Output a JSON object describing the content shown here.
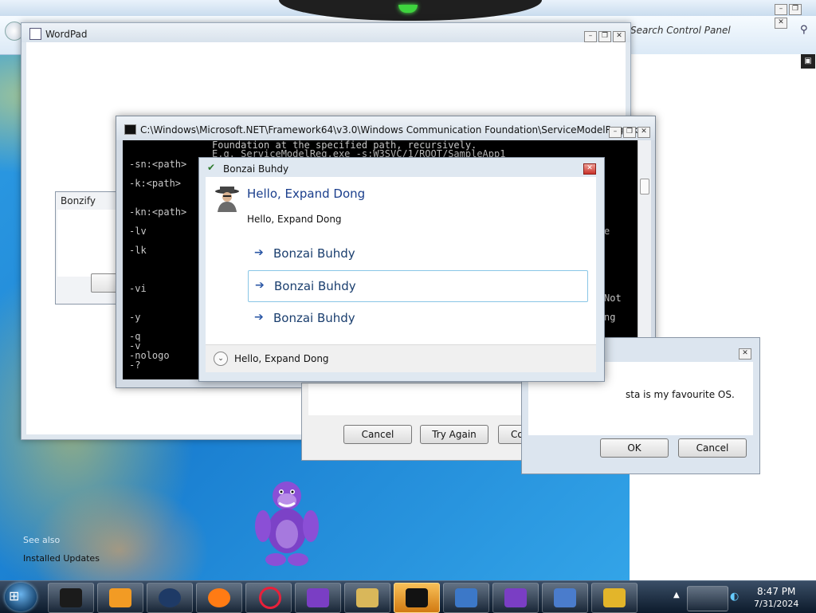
{
  "control_panel": {
    "search_placeholder": "Search Control Panel",
    "see_also": "See also",
    "installed_updates": "Installed Updates"
  },
  "wordpad": {
    "title": "WordPad"
  },
  "bonzify": {
    "title": "Bonzify"
  },
  "cmd": {
    "title": "C:\\Windows\\Microsoft.NET\\Framework64\\v3.0\\Windows Communication Foundation\\ServiceModelReg.exe",
    "lines": [
      {
        "left": "",
        "right": "Foundation at the specified path, recursively."
      },
      {
        "left": "",
        "right": "E.g. ServiceModelReg.exe -s:W3SVC/1/ROOT/SampleApp1"
      },
      {
        "left": "-sn:<path>",
        "right": ""
      },
      {
        "left": "-k:<path>",
        "right": ""
      },
      {
        "left": "-kn:<path>",
        "right": ""
      },
      {
        "left": "-lv",
        "right": ""
      },
      {
        "left": "-lk",
        "right": ""
      },
      {
        "left": "-vi",
        "right": ""
      },
      {
        "left": "-y",
        "right": ""
      },
      {
        "left": "-q",
        "right": ""
      },
      {
        "left": "-v",
        "right": ""
      },
      {
        "left": "-nologo",
        "right": ""
      },
      {
        "left": "-?",
        "right": ""
      }
    ],
    "right_fragments": [
      "e",
      "Not",
      "ng"
    ]
  },
  "try_again_dialog": {
    "buttons": [
      "Cancel",
      "Try Again",
      "Continue"
    ]
  },
  "vista_dialog": {
    "message": "sta is my favourite OS.",
    "ok_label": "OK",
    "cancel_label": "Cancel"
  },
  "bonzai_dialog": {
    "title": "Bonzai Buhdy",
    "main_instruction": "Hello, Expand Dong",
    "content": "Hello, Expand Dong",
    "command_links": [
      "Bonzai Buhdy",
      "Bonzai Buhdy",
      "Bonzai Buhdy"
    ],
    "footer_text": "Hello, Expand Dong"
  },
  "taskbar": {
    "time": "8:47 PM",
    "date": "7/31/2024",
    "items": [
      {
        "name": "taskbar-item-black-box",
        "icon": "black-cube-icon",
        "color": "#1b1b1b"
      },
      {
        "name": "taskbar-item-media-player",
        "icon": "media-player-icon",
        "color": "#f29b24"
      },
      {
        "name": "taskbar-item-dark-globe",
        "icon": "dark-globe-icon",
        "color": "#1e3a66"
      },
      {
        "name": "taskbar-item-firefox",
        "icon": "firefox-icon",
        "color": "#ff7b14"
      },
      {
        "name": "taskbar-item-opera",
        "icon": "opera-icon",
        "color": "#e8203a"
      },
      {
        "name": "taskbar-item-bonzi",
        "icon": "bonzi-icon",
        "color": "#7a3ec4"
      },
      {
        "name": "taskbar-item-agent",
        "icon": "agent-character-icon",
        "color": "#d9b75a"
      },
      {
        "name": "taskbar-item-cmd",
        "icon": "console-icon",
        "color": "#121212",
        "active": true
      },
      {
        "name": "taskbar-item-wordpad",
        "icon": "wordpad-icon",
        "color": "#3c78c8"
      },
      {
        "name": "taskbar-item-bonzi-2",
        "icon": "bonzi-icon",
        "color": "#7a3ec4"
      },
      {
        "name": "taskbar-item-document",
        "icon": "document-icon",
        "color": "#4a7ccc"
      },
      {
        "name": "taskbar-item-setup",
        "icon": "setup-icon",
        "color": "#e3b52a"
      }
    ]
  },
  "colors": {
    "task_dialog_instruction": "#1a3e8c",
    "command_link_hover_border": "#89c6e6",
    "active_task_button": "#f0a030"
  }
}
